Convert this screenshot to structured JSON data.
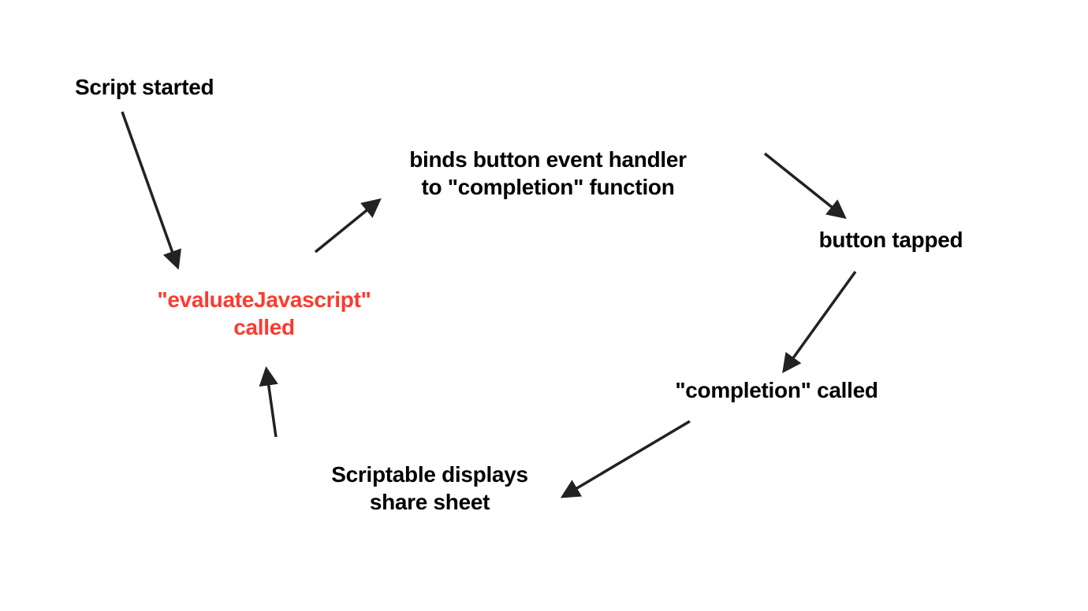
{
  "nodes": {
    "script_started": {
      "text": "Script started"
    },
    "evaluate_js": {
      "text": "\"evaluateJavascript\"\ncalled"
    },
    "binds_handler": {
      "text": "binds button event\nhandler to \"completion\"\nfunction"
    },
    "button_tapped": {
      "text": "button tapped"
    },
    "completion_called": {
      "text": "\"completion\" called"
    },
    "share_sheet": {
      "text": "Scriptable\ndisplays share\nsheet"
    }
  },
  "colors": {
    "highlight": "#fb3b2f",
    "arrow": "#222222"
  }
}
